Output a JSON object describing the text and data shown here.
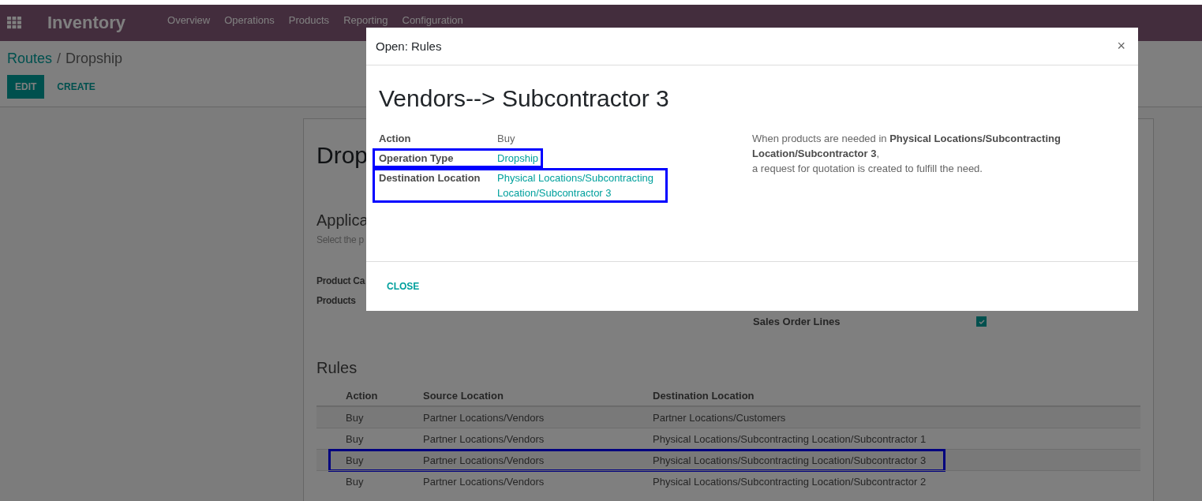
{
  "navbar": {
    "app_name": "Inventory",
    "menu": [
      "Overview",
      "Operations",
      "Products",
      "Reporting",
      "Configuration"
    ]
  },
  "breadcrumb": [
    {
      "label": "Routes",
      "kind": "link"
    },
    {
      "label": "/",
      "kind": "separator"
    },
    {
      "label": "Dropship",
      "kind": "current"
    }
  ],
  "buttons": [
    {
      "label": "EDIT",
      "kind": "primary"
    },
    {
      "label": "CREATE",
      "kind": "secondary"
    }
  ],
  "form": {
    "title": "Drop",
    "section": "Applica",
    "hint": "Select the p",
    "left_fields": [
      {
        "label": "Product Ca"
      },
      {
        "label": "Products"
      }
    ],
    "right_fields": [
      {
        "label": "Sales Order Lines",
        "checked": true
      }
    ]
  },
  "rules": {
    "heading": "Rules",
    "columns": [
      "Action",
      "Source Location",
      "Destination Location"
    ],
    "rows": [
      {
        "cells": [
          "Buy",
          "Partner Locations/Vendors",
          "Partner Locations/Customers"
        ],
        "highlighted": false
      },
      {
        "cells": [
          "Buy",
          "Partner Locations/Vendors",
          "Physical Locations/Subcontracting Location/Subcontractor 1"
        ],
        "highlighted": false
      },
      {
        "cells": [
          "Buy",
          "Partner Locations/Vendors",
          "Physical Locations/Subcontracting Location/Subcontractor 3"
        ],
        "highlighted": true
      },
      {
        "cells": [
          "Buy",
          "Partner Locations/Vendors",
          "Physical Locations/Subcontracting Location/Subcontractor 2"
        ],
        "highlighted": false
      }
    ]
  },
  "dialog": {
    "title": "Open: Rules",
    "close_icon": "×",
    "heading": "Vendors--> Subcontractor 3",
    "fields": [
      {
        "label": "Action",
        "value": "Buy",
        "kind": "text",
        "highlighted": false
      },
      {
        "label": "Operation Type",
        "value": "Dropship",
        "kind": "link",
        "highlighted": true
      },
      {
        "label": "Destination Location",
        "value": "Physical Locations/Subcontracting Location/Subcontractor 3",
        "kind": "link",
        "highlighted": true
      }
    ],
    "note": [
      "When products are needed in **Physical Locations/Subcontracting Location/Subcontractor 3**,",
      "a request for quotation is created to fulfill the need."
    ],
    "close_button": "CLOSE"
  }
}
